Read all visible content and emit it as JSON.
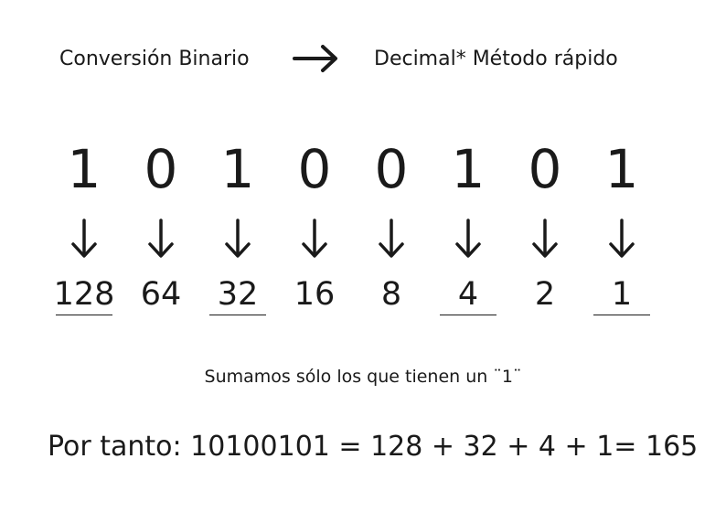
{
  "header": {
    "left_text": "Conversión Binario",
    "right_text": "Decimal* Método rápido",
    "arrow_icon": "right-arrow-icon"
  },
  "digits": [
    "1",
    "0",
    "1",
    "0",
    "0",
    "1",
    "0",
    "1"
  ],
  "weights": [
    "128",
    "64",
    "32",
    "16",
    "8",
    "4",
    "2",
    "1"
  ],
  "selected": [
    true,
    false,
    true,
    false,
    false,
    true,
    false,
    true
  ],
  "down_arrow_icon": "down-arrow-icon",
  "note": "Sumamos sólo los que tienen un ¨1¨",
  "result": "Por tanto: 10100101 = 128 + 32 + 4 + 1= 165"
}
